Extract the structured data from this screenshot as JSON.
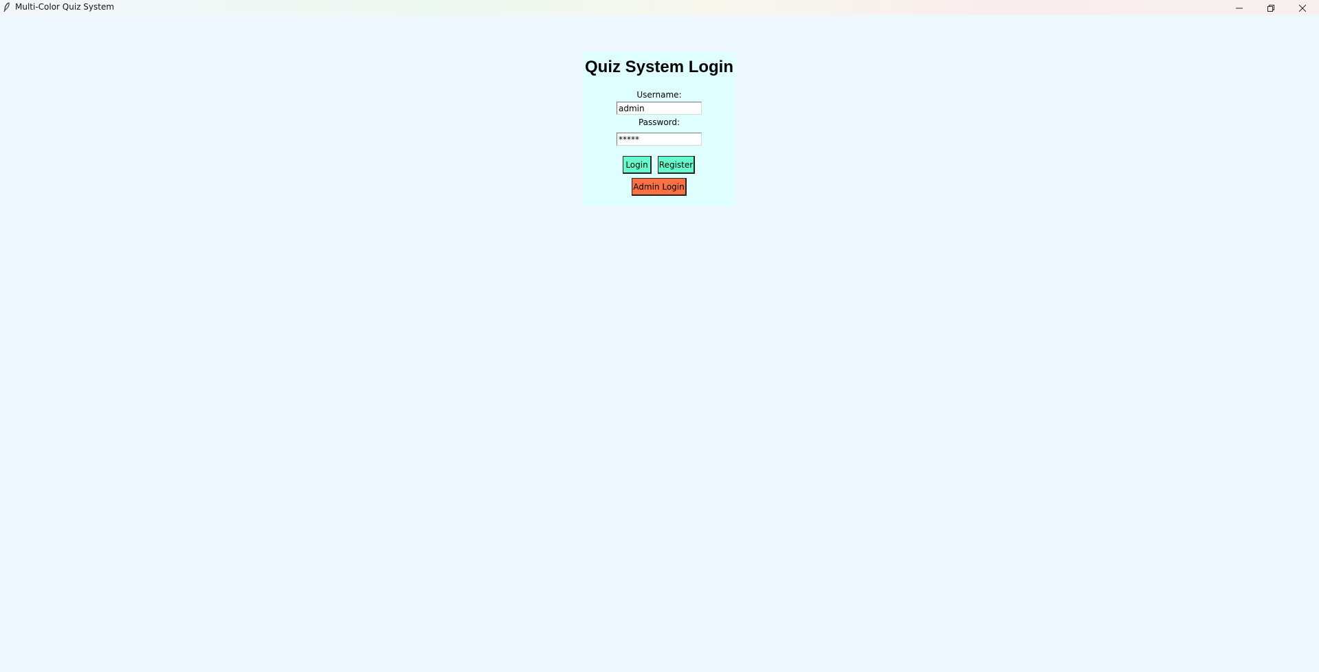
{
  "window": {
    "title": "Multi-Color Quiz System",
    "icons": {
      "app": "feather-icon",
      "minimize": "minimize-icon",
      "maximize": "restore-icon",
      "close": "close-icon"
    }
  },
  "login": {
    "title": "Quiz System Login",
    "username_label": "Username:",
    "username_value": "admin",
    "password_label": "Password:",
    "password_value": "*****",
    "login_button": "Login",
    "register_button": "Register",
    "admin_login_button": "Admin Login"
  },
  "colors": {
    "background": "#f0f8ff",
    "panel": "#e0ffff",
    "primary_button": "#66ffcc",
    "admin_button": "#ff7043"
  }
}
